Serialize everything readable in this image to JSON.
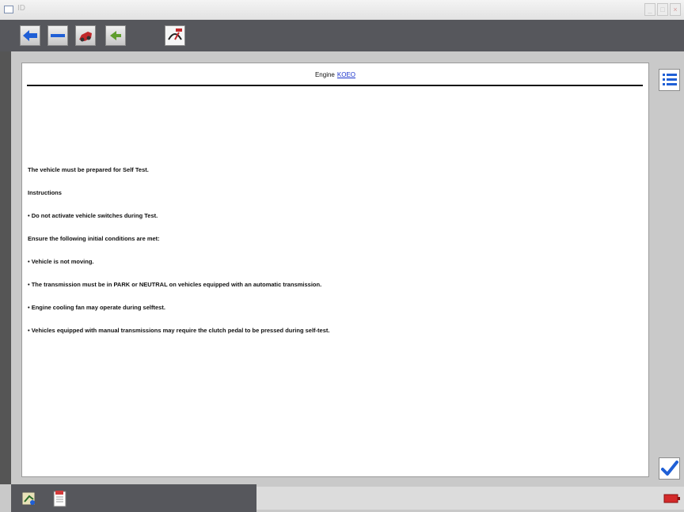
{
  "window": {
    "title": "ID",
    "controls": [
      "minimize-icon",
      "maximize-icon",
      "close-icon"
    ]
  },
  "toolbar": {
    "buttons": [
      {
        "name": "back-button",
        "icon": "blue-left-arrow-icon"
      },
      {
        "name": "minus-button",
        "icon": "blue-minus-icon"
      },
      {
        "name": "vehicle-button",
        "icon": "red-car-icon"
      },
      {
        "name": "go-button",
        "icon": "green-arrow-icon"
      },
      {
        "name": "recorder-button",
        "icon": "voltmeter-icon"
      }
    ]
  },
  "content": {
    "header_prefix": "Engine",
    "header_link": "KOEO",
    "lines": [
      "The vehicle must be prepared for Self Test.",
      "Instructions",
      "• Do not activate vehicle switches during Test.",
      "Ensure the following initial conditions are met:",
      "• Vehicle is not moving.",
      "• The transmission must be in PARK or NEUTRAL on vehicles equipped with an automatic transmission.",
      "• Engine cooling fan may operate during selftest.",
      "• Vehicles equipped with manual transmissions may require the clutch pedal to be pressed during self-test."
    ]
  },
  "side": {
    "list_icon": "list-icon",
    "confirm_icon": "checkmark-icon"
  },
  "bottom": {
    "buttons": [
      "toolbox-icon",
      "report-icon"
    ],
    "status_icon": "battery-icon"
  },
  "colors": {
    "toolbar_bg": "#56575c",
    "frame_bg": "#c9c9c9",
    "link": "#1a33cc",
    "accent_blue": "#1f5fd6"
  }
}
